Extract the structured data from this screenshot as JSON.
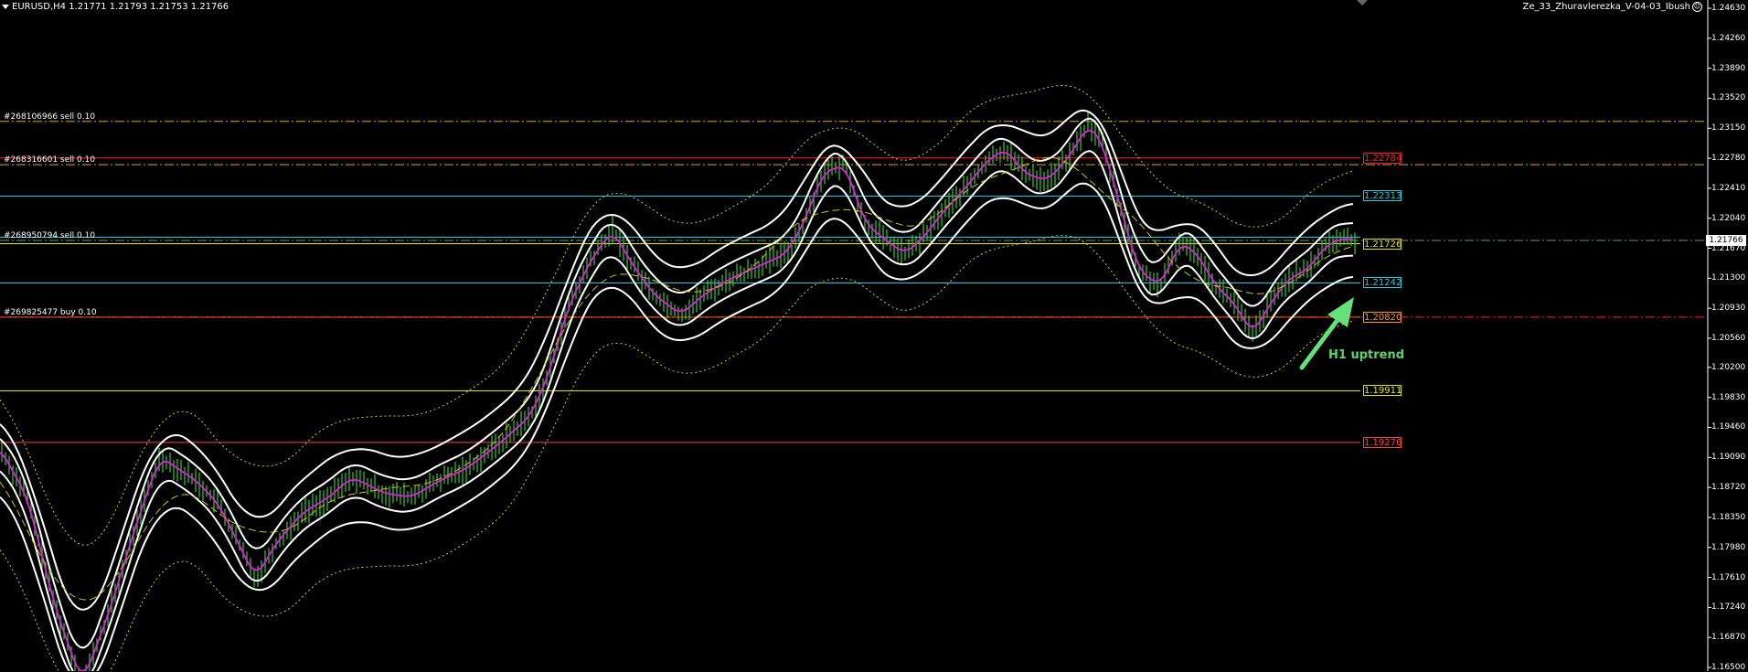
{
  "header": {
    "symbol_line": "EURUSD,H4  1.21771 1.21793 1.21753 1.21766",
    "expert": "Ze_33_Zhuravlerezka_V-04-03_Ibush"
  },
  "orders": [
    {
      "label": "#268106966 sell 0.10",
      "price": 1.23235,
      "color": "#d9a520",
      "style": "dashdot",
      "label_color": "#ffffff"
    },
    {
      "label": "#268316601 sell 0.10",
      "price": 1.227,
      "color": "#d9a520",
      "style": "dashdot",
      "label_color": "#ffffff"
    },
    {
      "label": "#268950794 sell 0.10",
      "price": 1.21766,
      "color": "#5aa05a",
      "style": "dashdot",
      "label_color": "#ffffff"
    },
    {
      "label": "#269825477 buy 0.10",
      "price": 1.2082,
      "color": "#ff2020",
      "style": "dashdot",
      "label_color": "#ffffff"
    }
  ],
  "levels": [
    {
      "value": "1.22784",
      "price": 1.22784,
      "color": "#ff2020"
    },
    {
      "value": "1.22313",
      "price": 1.22313,
      "color": "#20c8e0"
    },
    {
      "value": "1.21726",
      "price": 1.21726,
      "color": "#e6e600"
    },
    {
      "value": "1.21242",
      "price": 1.21242,
      "color": "#20c8e0"
    },
    {
      "value": "1.20820",
      "price": 1.2082,
      "color": "#ff9900"
    },
    {
      "value": "1.19911",
      "price": 1.19911,
      "color": "#e6e600"
    },
    {
      "value": "1.19276",
      "price": 1.19276,
      "color": "#ff4040"
    }
  ],
  "extra_lines": [
    {
      "price": 1.21806,
      "color": "#20c8e0"
    }
  ],
  "price_axis": {
    "ticks": [
      "1.24630",
      "1.24260",
      "1.23890",
      "1.23520",
      "1.23150",
      "1.22780",
      "1.22410",
      "1.22040",
      "1.21670",
      "1.21300",
      "1.20930",
      "1.20560",
      "1.20200",
      "1.19830",
      "1.19460",
      "1.19090",
      "1.18720",
      "1.18350",
      "1.17980",
      "1.17610",
      "1.17240",
      "1.16870",
      "1.16500"
    ],
    "current": "1.21766",
    "current_price": 1.21766,
    "scale_top": 1.2463,
    "scale_bottom": 1.165
  },
  "annotation": "H1 uptrend",
  "colors": {
    "candles": "#33cc33",
    "bands": "#ffffff",
    "fast_ma": "#e020e0",
    "slow_ma": "#c8c800",
    "envelope": "#d0d000",
    "arrow": "#66e07a"
  }
}
